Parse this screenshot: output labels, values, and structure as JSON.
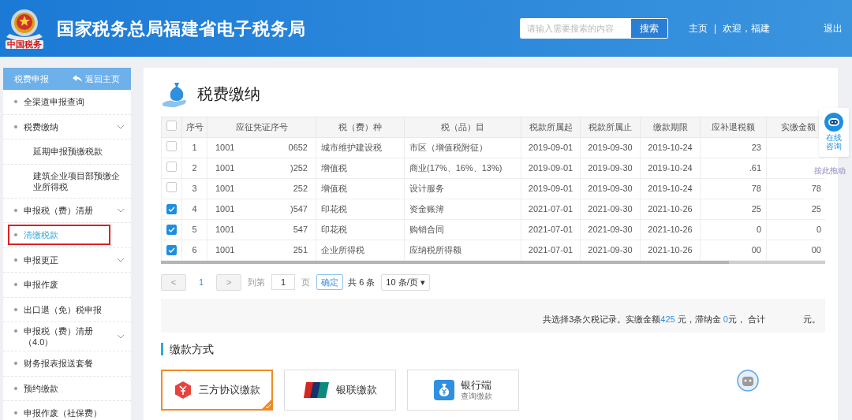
{
  "header": {
    "logo_caption": "中国税务",
    "title": "国家税务总局福建省电子税务局",
    "search": {
      "placeholder": "请输入需要搜索的内容",
      "button": "搜索"
    },
    "nav": [
      "主页",
      "|",
      "欢迎，福建"
    ],
    "logout": "退出"
  },
  "sidebar": {
    "title": "税费申报",
    "back": "返回主页",
    "items": [
      {
        "label": "全渠道申报查询",
        "expandable": false,
        "selected": false
      },
      {
        "label": "税费缴纳",
        "expandable": true,
        "selected": false,
        "children": [
          {
            "label": "延期申报预缴税款"
          },
          {
            "label": "建筑企业项目部预缴企业所得税"
          }
        ]
      },
      {
        "label": "申报税（费）清册",
        "expandable": true,
        "selected": false
      },
      {
        "label": "清缴税款",
        "expandable": false,
        "selected": true
      },
      {
        "label": "申报更正",
        "expandable": true,
        "selected": false
      },
      {
        "label": "申报作废",
        "expandable": false,
        "selected": false
      },
      {
        "label": "出口退（免）税申报",
        "expandable": false,
        "selected": false
      },
      {
        "label": "申报税（费）清册（4.0）",
        "expandable": true,
        "selected": false
      },
      {
        "label": "财务报表报送套餐",
        "expandable": false,
        "selected": false
      },
      {
        "label": "预约缴款",
        "expandable": false,
        "selected": false
      },
      {
        "label": "申报作废（社保费）",
        "expandable": false,
        "selected": false
      }
    ]
  },
  "page_title": "税费缴纳",
  "table": {
    "all_checked": false,
    "columns": [
      "序号",
      "应征凭证序号",
      "税（费）种",
      "税（品）目",
      "税款所属起",
      "税款所属止",
      "缴款期限",
      "应补退税额",
      "实缴金额"
    ],
    "rows": [
      {
        "checked": false,
        "no": "1",
        "cert_prefix": "1001",
        "cert_suffix": "0652",
        "tax": "城市维护建设税",
        "item": "市区（增值税附征）",
        "from": "2019-09-01",
        "to": "2019-09-30",
        "due": "2019-10-24",
        "amount": "23"
      },
      {
        "checked": false,
        "no": "2",
        "cert_prefix": "1001",
        "cert_suffix": ")252",
        "tax": "增值税",
        "item": "商业(17%、16%、13%)",
        "from": "2019-09-01",
        "to": "2019-09-30",
        "due": "2019-10-24",
        "amount": ".61"
      },
      {
        "checked": false,
        "no": "3",
        "cert_prefix": "1001",
        "cert_suffix": "252",
        "tax": "增值税",
        "item": "设计服务",
        "from": "2019-09-01",
        "to": "2019-09-30",
        "due": "2019-10-24",
        "amount": "78",
        "paid": "78"
      },
      {
        "checked": true,
        "no": "4",
        "cert_prefix": "1001",
        "cert_suffix": ")547",
        "tax": "印花税",
        "item": "资金账簿",
        "from": "2021-07-01",
        "to": "2021-09-30",
        "due": "2021-10-26",
        "amount": "25",
        "paid": "25"
      },
      {
        "checked": true,
        "no": "5",
        "cert_prefix": "1001",
        "cert_suffix": "547",
        "tax": "印花税",
        "item": "购销合同",
        "from": "2021-07-01",
        "to": "2021-09-30",
        "due": "2021-10-26",
        "amount": "0",
        "paid": "0"
      },
      {
        "checked": true,
        "no": "6",
        "cert_prefix": "1001",
        "cert_suffix": "251",
        "tax": "企业所得税",
        "item": "应纳税所得额",
        "from": "2021-07-01",
        "to": "2021-09-30",
        "due": "2021-10-26",
        "amount": "00",
        "paid": "00"
      }
    ]
  },
  "pagination": {
    "prev": "<",
    "page": "1",
    "next": ">",
    "goto_label": "到第",
    "goto_value": "1",
    "page_unit": "页",
    "confirm": "确定",
    "total": "共 6 条",
    "page_size": "10 条/页 ▾"
  },
  "summary": [
    {
      "kind": "text",
      "text": "共选择3条欠税记录。实缴金额"
    },
    {
      "kind": "amount",
      "text": "425"
    },
    {
      "kind": "text",
      "text": " 元，滞纳金 "
    },
    {
      "kind": "amount",
      "text": "0"
    },
    {
      "kind": "text",
      "text": "元， 合计"
    },
    {
      "kind": "gap"
    },
    {
      "kind": "text",
      "text": "元。"
    }
  ],
  "payment_section": "缴款方式",
  "payment_methods": [
    {
      "kind": "tripartite",
      "label": "三方协议缴款",
      "selected": true
    },
    {
      "kind": "unionpay",
      "label": "银联缴款",
      "selected": false
    },
    {
      "kind": "bank",
      "label": "银行端",
      "sub": "查询缴款",
      "selected": false
    }
  ],
  "chat": {
    "label": "在线咨询",
    "drag_hint": "按此拖动"
  }
}
